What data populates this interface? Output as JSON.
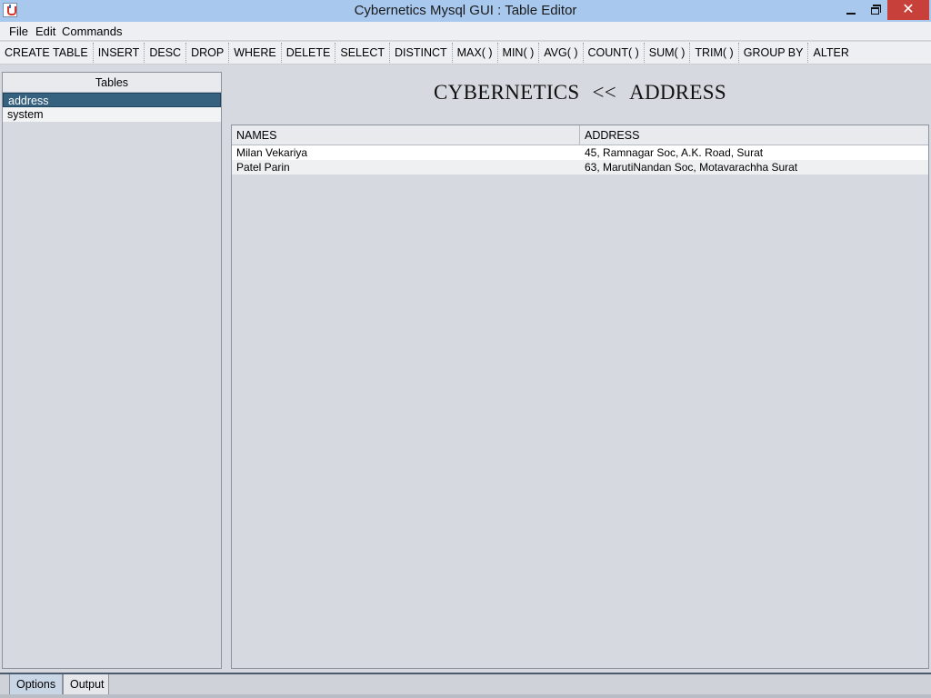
{
  "window": {
    "title": "Cybernetics Mysql GUI  :  Table Editor",
    "minimize_icon": "minimize-icon",
    "maximize_icon": "restore-icon",
    "close_icon": "close-icon",
    "close_glyph": "✕"
  },
  "menu": {
    "items": [
      "File",
      "Edit",
      "Commands"
    ]
  },
  "toolbar": {
    "buttons": [
      "CREATE TABLE",
      "INSERT",
      "DESC",
      "DROP",
      "WHERE",
      "DELETE",
      "SELECT",
      "DISTINCT",
      "MAX( )",
      "MIN( )",
      "AVG( )",
      "COUNT( )",
      "SUM( )",
      "TRIM( )",
      "GROUP BY",
      "ALTER"
    ]
  },
  "tables_panel": {
    "header": "Tables",
    "items": [
      {
        "label": "address",
        "selected": true
      },
      {
        "label": "system",
        "selected": false
      }
    ]
  },
  "heading": {
    "database": "CYBERNETICS",
    "separator": "<<",
    "table": "ADDRESS"
  },
  "data_table": {
    "columns": [
      "NAMES",
      "ADDRESS"
    ],
    "rows": [
      [
        "Milan Vekariya",
        "45, Ramnagar Soc, A.K. Road, Surat"
      ],
      [
        "Patel Parin",
        "63, MarutiNandan Soc, Motavarachha Surat"
      ]
    ]
  },
  "bottom_tabs": [
    {
      "label": "Options",
      "active": true
    },
    {
      "label": "Output",
      "active": false
    }
  ]
}
